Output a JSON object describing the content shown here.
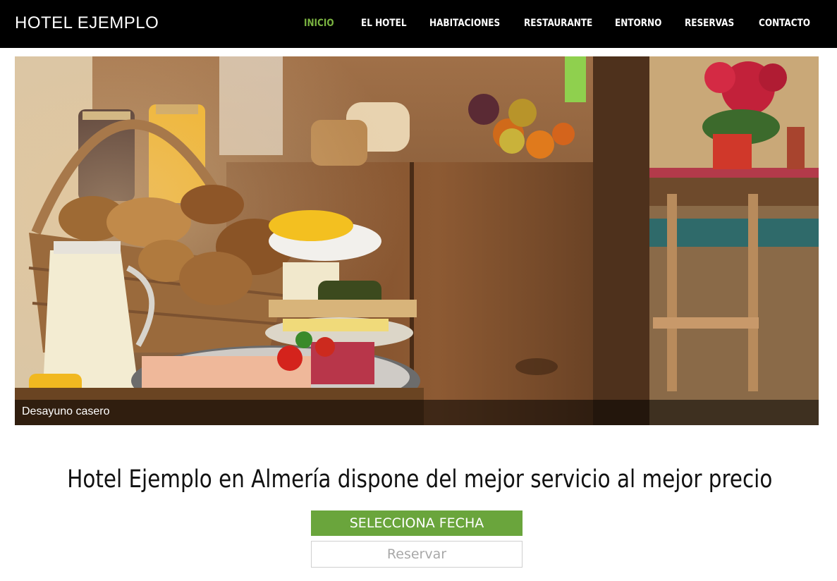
{
  "header": {
    "brand": "HOTEL EJEMPLO",
    "nav": [
      {
        "label": "INICIO",
        "active": true
      },
      {
        "label": "EL HOTEL",
        "active": false
      },
      {
        "label": "HABITACIONES",
        "active": false
      },
      {
        "label": "RESTAURANTE",
        "active": false
      },
      {
        "label": "ENTORNO",
        "active": false
      },
      {
        "label": "RESERVAS",
        "active": false
      },
      {
        "label": "CONTACTO",
        "active": false
      }
    ]
  },
  "hero": {
    "caption": "Desayuno casero",
    "image": "breakfast-buffet-photo"
  },
  "main": {
    "headline": "Hotel Ejemplo en Almería dispone del mejor servicio al mejor precio",
    "select_date_label": "SELECCIONA FECHA",
    "reserve_label": "Reservar"
  },
  "colors": {
    "header_bg": "#000000",
    "active_nav": "#7bb441",
    "primary_button": "#6aa53c"
  }
}
